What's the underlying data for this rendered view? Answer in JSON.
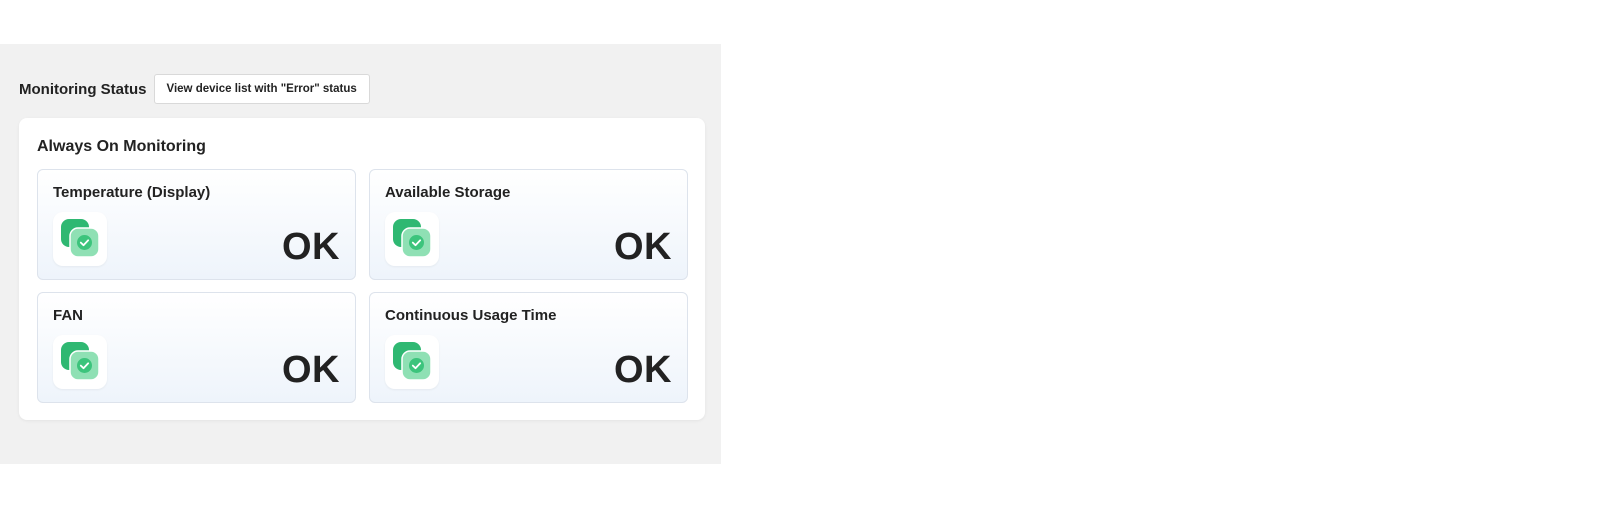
{
  "header": {
    "title": "Monitoring Status",
    "error_button_label": "View device list with \"Error\" status"
  },
  "monitoring": {
    "title": "Always On Monitoring",
    "items": [
      {
        "label": "Temperature (Display)",
        "status": "OK",
        "icon": "status-ok-icon"
      },
      {
        "label": "Available Storage",
        "status": "OK",
        "icon": "status-ok-icon"
      },
      {
        "label": "FAN",
        "status": "OK",
        "icon": "status-ok-icon"
      },
      {
        "label": "Continuous Usage Time",
        "status": "OK",
        "icon": "status-ok-icon"
      }
    ]
  },
  "colors": {
    "panel_bg": "#f1f1f1",
    "ok_green_dark": "#2fb872",
    "ok_green_light": "#8fe0b4"
  }
}
